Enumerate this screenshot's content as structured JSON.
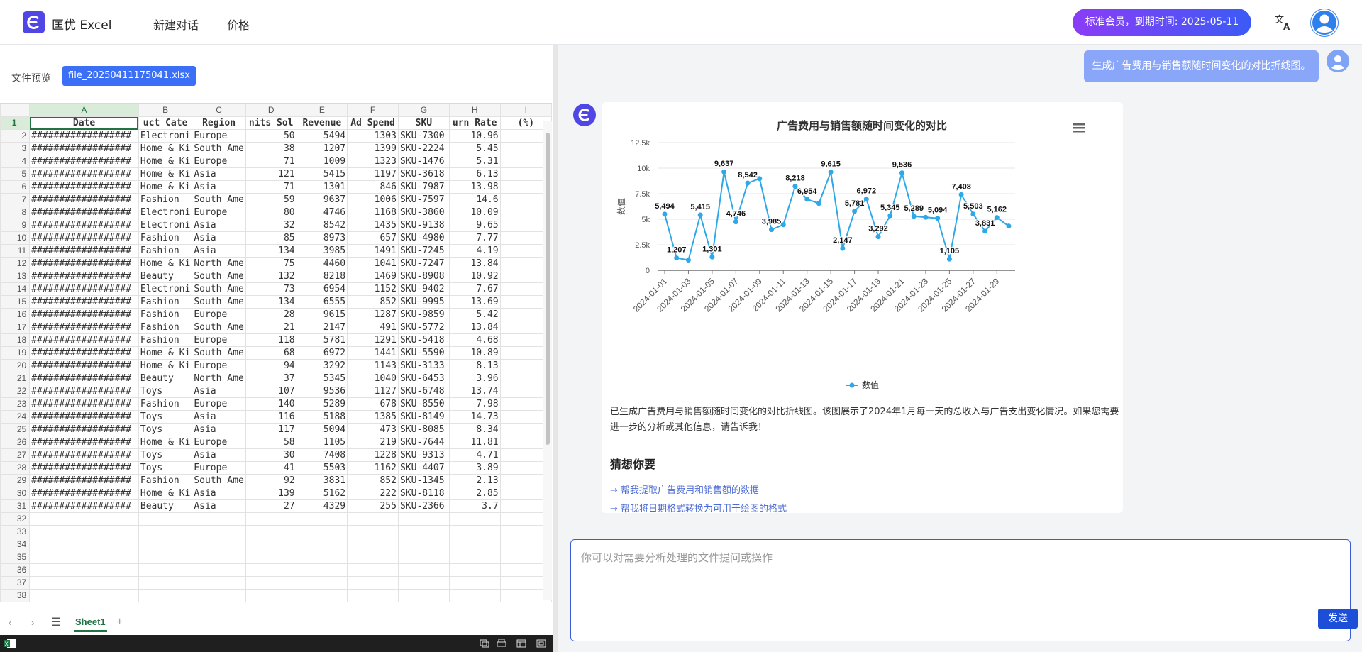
{
  "header": {
    "brand": "匡优 Excel",
    "nav": [
      "新建对话",
      "价格"
    ],
    "membership": "标准会员，到期时间: 2025-05-11"
  },
  "file_panel": {
    "preview_label": "文件预览",
    "file_name": "file_20250411175041.xlsx",
    "sheet_tab": "Sheet1"
  },
  "spreadsheet": {
    "columns": [
      "A",
      "B",
      "C",
      "D",
      "E",
      "F",
      "G",
      "H",
      "I"
    ],
    "header_row": [
      "Date",
      "uct Cate",
      "Region",
      "nits Sol",
      "Revenue",
      "Ad Spend",
      "SKU",
      "urn Rate",
      "(%)"
    ],
    "rows": [
      [
        "##################",
        "Electroni",
        "Europe",
        "50",
        "5494",
        "1303",
        "SKU-7300",
        "10.96"
      ],
      [
        "##################",
        "Home & Ki",
        "South Ame",
        "38",
        "1207",
        "1399",
        "SKU-2224",
        "5.45"
      ],
      [
        "##################",
        "Home & Ki",
        "Europe",
        "71",
        "1009",
        "1323",
        "SKU-1476",
        "5.31"
      ],
      [
        "##################",
        "Home & Ki",
        "Asia",
        "121",
        "5415",
        "1197",
        "SKU-3618",
        "6.13"
      ],
      [
        "##################",
        "Home & Ki",
        "Asia",
        "71",
        "1301",
        "846",
        "SKU-7987",
        "13.98"
      ],
      [
        "##################",
        "Fashion",
        "South Ame",
        "59",
        "9637",
        "1006",
        "SKU-7597",
        "14.6"
      ],
      [
        "##################",
        "Electroni",
        "Europe",
        "80",
        "4746",
        "1168",
        "SKU-3860",
        "10.09"
      ],
      [
        "##################",
        "Electroni",
        "Asia",
        "32",
        "8542",
        "1435",
        "SKU-9138",
        "9.65"
      ],
      [
        "##################",
        "Fashion",
        "Asia",
        "85",
        "8973",
        "657",
        "SKU-4980",
        "7.77"
      ],
      [
        "##################",
        "Fashion",
        "Asia",
        "134",
        "3985",
        "1491",
        "SKU-7245",
        "4.19"
      ],
      [
        "##################",
        "Home & Ki",
        "North Ame",
        "75",
        "4460",
        "1041",
        "SKU-7247",
        "13.84"
      ],
      [
        "##################",
        "Beauty",
        "South Ame",
        "132",
        "8218",
        "1469",
        "SKU-8908",
        "10.92"
      ],
      [
        "##################",
        "Electroni",
        "South Ame",
        "73",
        "6954",
        "1152",
        "SKU-9402",
        "7.67"
      ],
      [
        "##################",
        "Fashion",
        "South Ame",
        "134",
        "6555",
        "852",
        "SKU-9995",
        "13.69"
      ],
      [
        "##################",
        "Fashion",
        "Europe",
        "28",
        "9615",
        "1287",
        "SKU-9859",
        "5.42"
      ],
      [
        "##################",
        "Fashion",
        "South Ame",
        "21",
        "2147",
        "491",
        "SKU-5772",
        "13.84"
      ],
      [
        "##################",
        "Fashion",
        "Europe",
        "118",
        "5781",
        "1291",
        "SKU-5418",
        "4.68"
      ],
      [
        "##################",
        "Home & Ki",
        "South Ame",
        "68",
        "6972",
        "1441",
        "SKU-5590",
        "10.89"
      ],
      [
        "##################",
        "Home & Ki",
        "Europe",
        "94",
        "3292",
        "1143",
        "SKU-3133",
        "8.13"
      ],
      [
        "##################",
        "Beauty",
        "North Ame",
        "37",
        "5345",
        "1040",
        "SKU-6453",
        "3.96"
      ],
      [
        "##################",
        "Toys",
        "Asia",
        "107",
        "9536",
        "1127",
        "SKU-6748",
        "13.74"
      ],
      [
        "##################",
        "Fashion",
        "Europe",
        "140",
        "5289",
        "678",
        "SKU-8550",
        "7.98"
      ],
      [
        "##################",
        "Toys",
        "Asia",
        "116",
        "5188",
        "1385",
        "SKU-8149",
        "14.73"
      ],
      [
        "##################",
        "Toys",
        "Asia",
        "117",
        "5094",
        "473",
        "SKU-8085",
        "8.34"
      ],
      [
        "##################",
        "Home & Ki",
        "Europe",
        "58",
        "1105",
        "219",
        "SKU-7644",
        "11.81"
      ],
      [
        "##################",
        "Toys",
        "Asia",
        "30",
        "7408",
        "1228",
        "SKU-9313",
        "4.71"
      ],
      [
        "##################",
        "Toys",
        "Europe",
        "41",
        "5503",
        "1162",
        "SKU-4407",
        "3.89"
      ],
      [
        "##################",
        "Fashion",
        "South Ame",
        "92",
        "3831",
        "852",
        "SKU-1345",
        "2.13"
      ],
      [
        "##################",
        "Home & Ki",
        "Asia",
        "139",
        "5162",
        "222",
        "SKU-8118",
        "2.85"
      ],
      [
        "##################",
        "Beauty",
        "Asia",
        "27",
        "4329",
        "255",
        "SKU-2366",
        "3.7"
      ]
    ],
    "total_visible_rows": 38
  },
  "chat": {
    "user_message": "生成广告费用与销售额随时间变化的对比折线图。",
    "answer": "已生成广告费用与销售额随时间变化的对比折线图。该图展示了2024年1月每一天的总收入与广告支出变化情况。如果您需要进一步的分析或其他信息，请告诉我！",
    "guess_title": "猜想你要",
    "suggestions": [
      "→ 帮我提取广告费用和销售额的数据",
      "→ 帮我将日期格式转换为可用于绘图的格式"
    ],
    "input_placeholder": "你可以对需要分析处理的文件提问或操作",
    "send_label": "发送"
  },
  "chart_data": {
    "type": "line",
    "title": "广告费用与销售额随时间变化的对比",
    "ylabel": "数值",
    "xlabel": "",
    "ylim": [
      0,
      12500
    ],
    "yticks": [
      "0",
      "2.5k",
      "5k",
      "7.5k",
      "10k",
      "12.5k"
    ],
    "x": [
      "2024-01-01",
      "2024-01-02",
      "2024-01-03",
      "2024-01-04",
      "2024-01-05",
      "2024-01-06",
      "2024-01-07",
      "2024-01-08",
      "2024-01-09",
      "2024-01-10",
      "2024-01-11",
      "2024-01-12",
      "2024-01-13",
      "2024-01-14",
      "2024-01-15",
      "2024-01-16",
      "2024-01-17",
      "2024-01-18",
      "2024-01-19",
      "2024-01-20",
      "2024-01-21",
      "2024-01-22",
      "2024-01-23",
      "2024-01-24",
      "2024-01-25",
      "2024-01-26",
      "2024-01-27",
      "2024-01-28",
      "2024-01-29",
      "2024-01-30"
    ],
    "xtick_labels": [
      "2024-01-01",
      "2024-01-03",
      "2024-01-05",
      "2024-01-07",
      "2024-01-09",
      "2024-01-11",
      "2024-01-13",
      "2024-01-15",
      "2024-01-17",
      "2024-01-19",
      "2024-01-21",
      "2024-01-23",
      "2024-01-25",
      "2024-01-27",
      "2024-01-29"
    ],
    "series": [
      {
        "name": "数值",
        "color": "#2fa8e8",
        "values": [
          5494,
          1207,
          1009,
          5415,
          1301,
          9637,
          4746,
          8542,
          8973,
          3985,
          4460,
          8218,
          6954,
          6555,
          9615,
          2147,
          5781,
          6972,
          3292,
          5345,
          9536,
          5289,
          5188,
          5094,
          1105,
          7408,
          5503,
          3831,
          5162,
          4329
        ],
        "data_labels": [
          true,
          true,
          false,
          true,
          true,
          true,
          true,
          true,
          false,
          true,
          false,
          true,
          true,
          false,
          true,
          true,
          true,
          true,
          true,
          true,
          true,
          true,
          false,
          true,
          true,
          true,
          true,
          true,
          true,
          false
        ]
      }
    ],
    "legend": "bottom-center",
    "grid": true
  },
  "colors": {
    "accent": "#4f46e5",
    "excel_green": "#217346",
    "send_button": "#1d4ed8"
  }
}
